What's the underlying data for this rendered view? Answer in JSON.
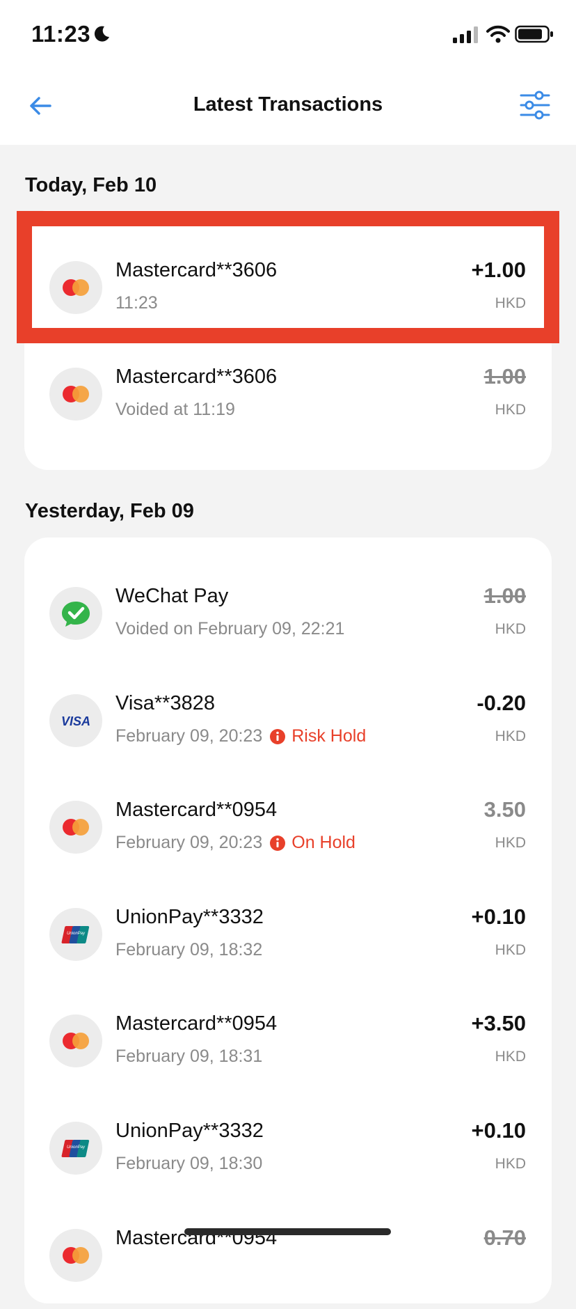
{
  "status_bar": {
    "time": "11:23"
  },
  "header": {
    "title": "Latest Transactions"
  },
  "sections": [
    {
      "date": "Today, Feb 10",
      "items": [
        {
          "name": "Mastercard**3606",
          "sub": "11:23",
          "amount": "+1.00",
          "currency": "HKD",
          "icon": "mastercard-icon"
        },
        {
          "name": "Mastercard**3606",
          "sub": "Voided at 11:19",
          "amount": "1.00",
          "currency": "HKD",
          "icon": "mastercard-icon"
        }
      ]
    },
    {
      "date": "Yesterday, Feb 09",
      "items": [
        {
          "name": "WeChat Pay",
          "sub": "Voided on February 09, 22:21",
          "amount": "1.00",
          "currency": "HKD",
          "icon": "wechat-pay-icon"
        },
        {
          "name": "Visa**3828",
          "sub": "February 09, 20:23",
          "warning": "Risk Hold",
          "amount": "-0.20",
          "currency": "HKD",
          "icon": "visa-icon"
        },
        {
          "name": "Mastercard**0954",
          "sub": "February 09, 20:23",
          "warning": "On Hold",
          "amount": "3.50",
          "currency": "HKD",
          "icon": "mastercard-icon"
        },
        {
          "name": "UnionPay**3332",
          "sub": "February 09, 18:32",
          "amount": "+0.10",
          "currency": "HKD",
          "icon": "unionpay-icon"
        },
        {
          "name": "Mastercard**0954",
          "sub": "February 09, 18:31",
          "amount": "+3.50",
          "currency": "HKD",
          "icon": "mastercard-icon"
        },
        {
          "name": "UnionPay**3332",
          "sub": "February 09, 18:30",
          "amount": "+0.10",
          "currency": "HKD",
          "icon": "unionpay-icon"
        },
        {
          "name": "Mastercard**0954",
          "amount": "0.70",
          "icon": "mastercard-icon"
        }
      ]
    }
  ],
  "logo_text": {
    "visa": "VISA",
    "unionpay": "UnionPay"
  },
  "colors": {
    "accent_blue": "#3b8be6",
    "highlight_red": "#e8402a",
    "warning_red": "#e8402a",
    "mastercard_red": "#eb2a2f",
    "mastercard_orange": "#f5a03a",
    "wechat_green": "#34b44a"
  }
}
